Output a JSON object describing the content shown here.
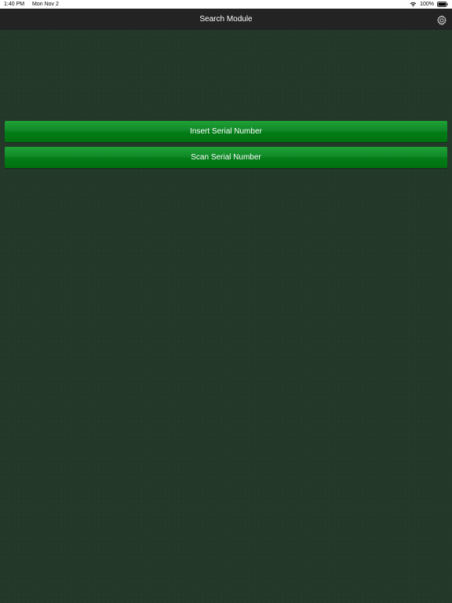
{
  "status_bar": {
    "time": "1:40 PM",
    "date": "Mon Nov 2",
    "battery": "100%",
    "wifi_icon": "wifi-icon",
    "battery_icon": "battery-icon"
  },
  "nav": {
    "title": "Search Module",
    "settings_icon": "gear-icon"
  },
  "buttons": {
    "insert_label": "Insert Serial Number",
    "scan_label": "Scan Serial Number"
  },
  "colors": {
    "background": "#24392a",
    "nav_bar": "#232323",
    "button_green": "#0a8a22"
  }
}
